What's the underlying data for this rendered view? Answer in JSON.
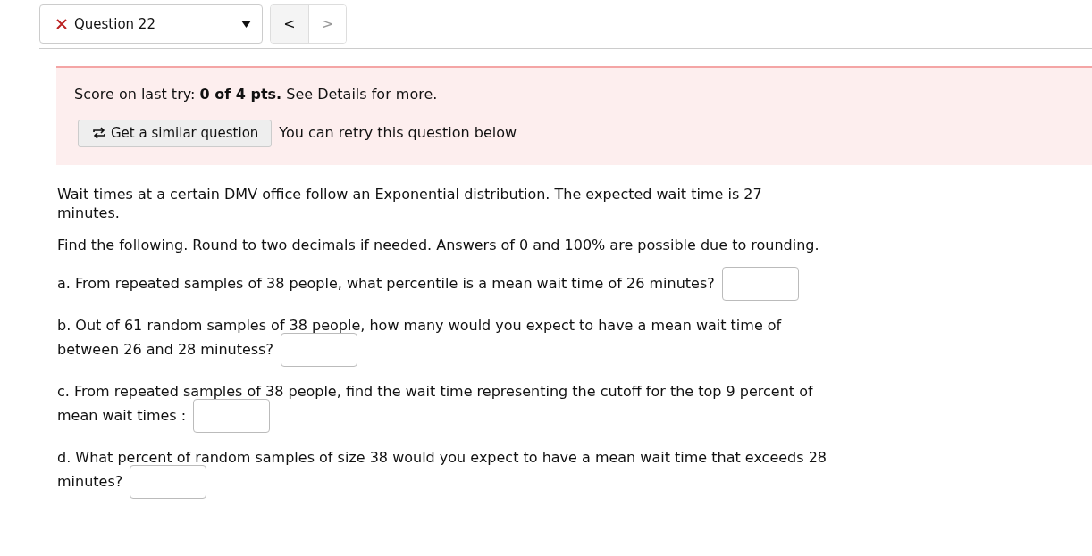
{
  "question_select": {
    "label": "Question 22",
    "incorrect": true
  },
  "nav_buttons": [
    {
      "label": "<",
      "disabled": false
    },
    {
      "label": ">",
      "disabled": true
    }
  ],
  "score_notice": {
    "text": "Score on last try: **0 of 4 pts.** See Details for more.",
    "button": "Get a similar question",
    "note": "You can retry this question below"
  },
  "intro": [
    "Wait times at a certain DMV office follow an Exponential distribution. The expected wait time is 27 minutes.",
    "Find the following. Round to two decimals if needed. Answers of 0 and 100% are possible due to rounding."
  ],
  "questions": [
    {
      "lines": [
        "a. From repeated samples of 38 people, what percentile is a mean wait time of 26 minutes?"
      ]
    },
    {
      "lines": [
        "b. Out of 61 random samples of 38 people, how many would you expect to have a mean wait time of",
        "between 26 and 28 minutess?"
      ]
    },
    {
      "lines": [
        "c. From repeated samples of 38 people, find the wait time representing the cutoff for the top 9 percent of",
        "mean wait times :"
      ]
    },
    {
      "lines": [
        "d. What percent of random samples of size 38 would you expect to have a mean wait time that exceeds 28",
        "minutes?"
      ]
    }
  ]
}
